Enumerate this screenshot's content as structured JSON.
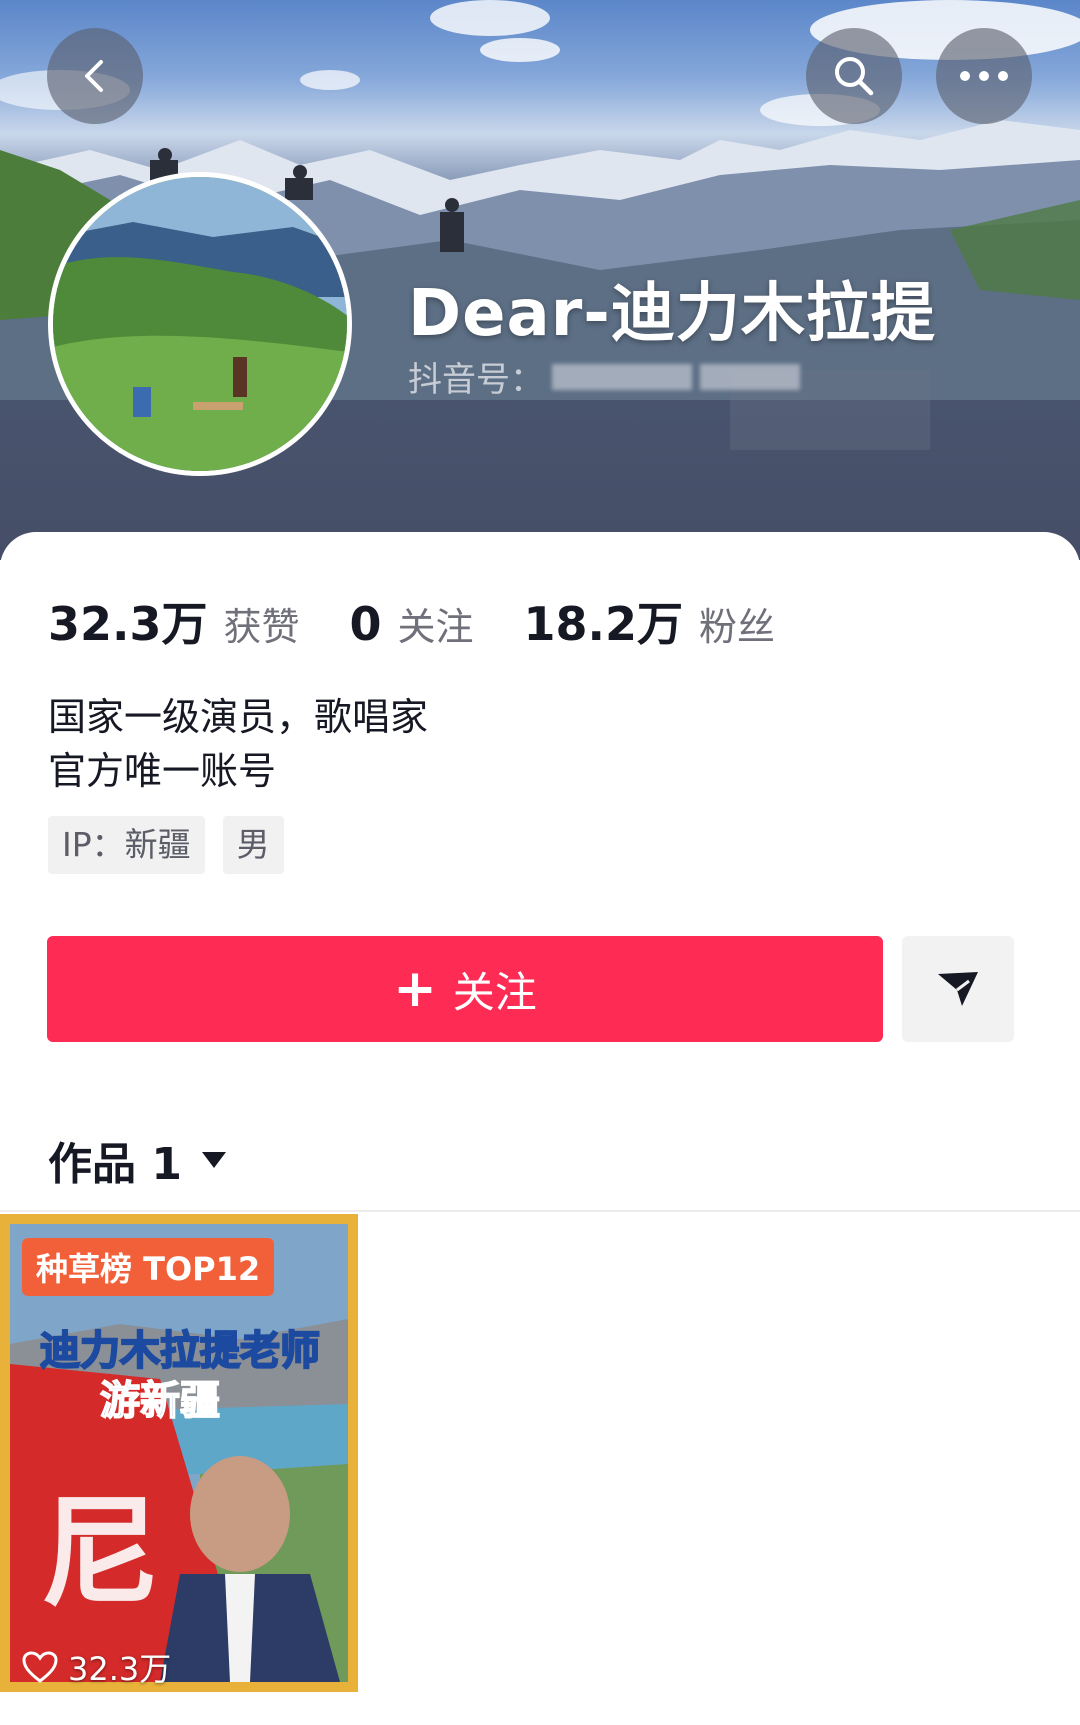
{
  "header": {
    "nickname": "Dear-迪力木拉提",
    "douyin_id_label": "抖音号："
  },
  "stats": [
    {
      "value": "32.3万",
      "label": "获赞"
    },
    {
      "value": "0",
      "label": "关注"
    },
    {
      "value": "18.2万",
      "label": "粉丝"
    }
  ],
  "bio": {
    "line1": "国家一级演员，歌唱家",
    "line2": "官方唯一账号"
  },
  "tags": [
    "IP：新疆",
    "男"
  ],
  "actions": {
    "follow_label": "关注",
    "follow_color": "#fe2c55"
  },
  "works": {
    "tab_label": "作品 1",
    "items": [
      {
        "badge": "种草榜 TOP12",
        "cover_title_1": "迪力木拉提老师",
        "cover_title_2": "游新疆",
        "likes": "32.3万"
      }
    ]
  },
  "icons": {
    "back": "chevron-left-icon",
    "search": "search-icon",
    "more": "more-dots-icon",
    "share": "share-arrow-icon",
    "like": "heart-icon"
  }
}
